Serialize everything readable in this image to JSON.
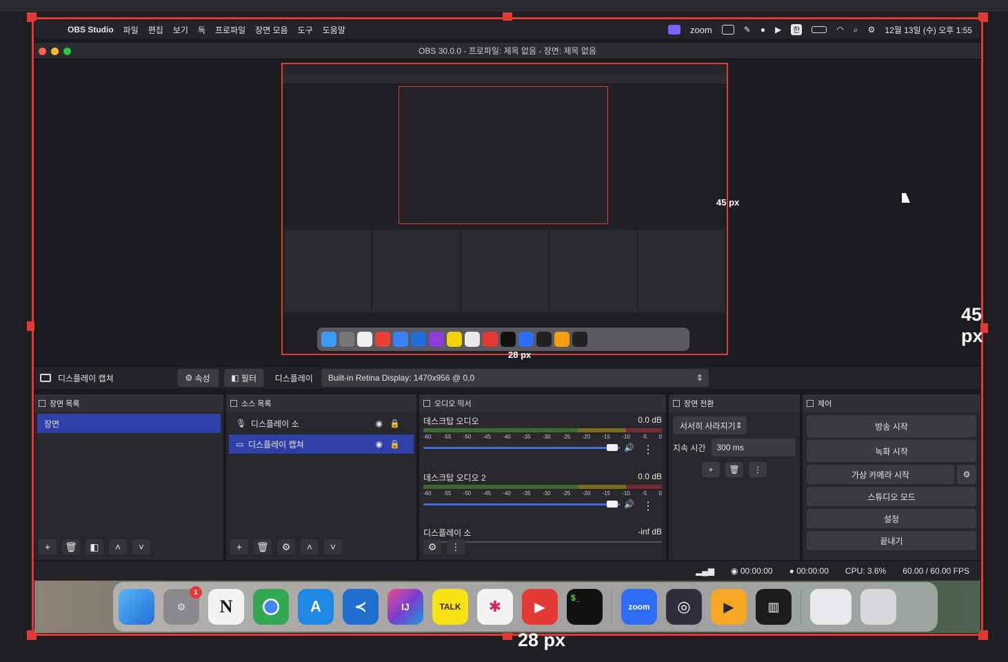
{
  "menubar": {
    "app_name": "OBS Studio",
    "items": [
      "파일",
      "편집",
      "보기",
      "독",
      "프로파일",
      "장면 모음",
      "도구",
      "도움말"
    ],
    "zoom_label": "zoom",
    "input_mode": "한",
    "datetime": "12월 13일 (수) 오후 1:55"
  },
  "window": {
    "title": "OBS 30.0.0 - 프로파일: 제목 없음 - 장면: 제목 없음"
  },
  "preview": {
    "offset_right_label": "45 px",
    "offset_bottom_label": "28 px",
    "outer_right_label": "45 px",
    "outer_bottom_label": "28 px"
  },
  "source_bar": {
    "source_name": "디스플레이 캡쳐",
    "properties_label": "속성",
    "filters_label": "필터",
    "display_label": "디스플레이",
    "display_value": "Built-in Retina Display: 1470x956 @ 0,0"
  },
  "scenes": {
    "title": "장면 목록",
    "items": [
      "장면"
    ]
  },
  "sources": {
    "title": "소스 목록",
    "items": [
      "디스플레이 소",
      "디스플레이 캡쳐"
    ]
  },
  "mixer": {
    "title": "오디오 믹서",
    "channels": [
      {
        "name": "데스크탑 오디오",
        "level": "0.0 dB"
      },
      {
        "name": "데스크탑 오디오 2",
        "level": "0.0 dB"
      },
      {
        "name": "디스플레이 소",
        "level": "-inf dB"
      }
    ],
    "scale": [
      "-60",
      "-55",
      "-50",
      "-45",
      "-40",
      "-35",
      "-30",
      "-25",
      "-20",
      "-15",
      "-10",
      "-5",
      "0"
    ]
  },
  "transitions": {
    "title": "장면 전환",
    "type": "서서히 사라지기",
    "duration_label": "지속 시간",
    "duration_value": "300 ms"
  },
  "controls": {
    "title": "제어",
    "buttons": [
      "방송 시작",
      "녹화 시작",
      "가상 카메라 시작",
      "스튜디오 모드",
      "설정",
      "끝내기"
    ]
  },
  "status": {
    "stream_time": "00:00:00",
    "rec_time": "00:00:00",
    "cpu": "CPU: 3.6%",
    "fps": "60.00 / 60.00 FPS"
  },
  "dock": {
    "settings_badge": "1",
    "zoom_label": "zoom",
    "talk_label": "TALK"
  }
}
